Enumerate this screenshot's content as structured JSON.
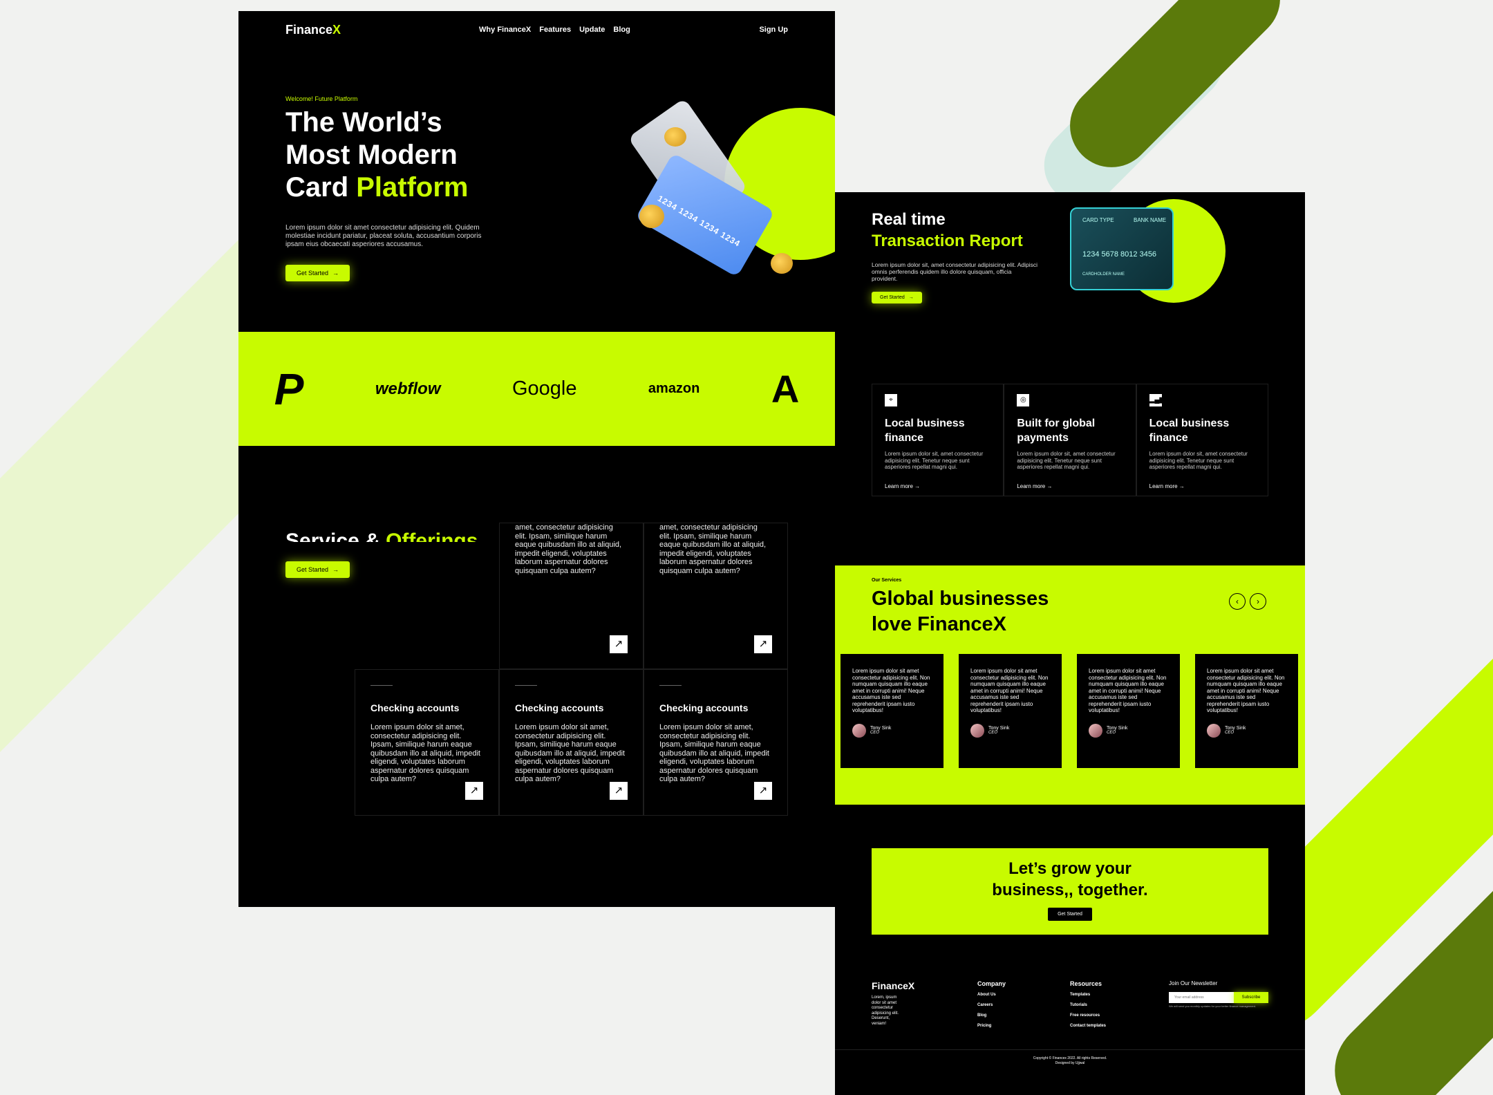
{
  "colors": {
    "accent": "#c8fb00",
    "bg": "#000000",
    "canvas": "#f1f2f0"
  },
  "page1": {
    "logo_main": "Finance",
    "logo_x": "X",
    "nav": [
      "Why FinanceX",
      "Features",
      "Update",
      "Blog"
    ],
    "signup": "Sign Up",
    "eyebrow": "Welcome! Future Platform",
    "hero_title_line1": "The World’s",
    "hero_title_line2": "Most Modern",
    "hero_title_line3a": "Card ",
    "hero_title_line3b": "Platform",
    "hero_desc": "Lorem ipsum dolor sit amet consectetur adipisicing elit. Quidem molestiae incidunt pariatur, placeat soluta, accusantium corporis ipsam eius obcaecati asperiores accusamus.",
    "hero_btn": "Get Started",
    "card_number": "1234 1234 1234 1234",
    "partners": [
      "P",
      "webflow",
      "Google",
      "amazon",
      "A"
    ],
    "offer_title_a": "Service & ",
    "offer_title_b": "Offerings",
    "offer_btn": "Get Started",
    "cell_title": "Checking accounts",
    "cell_desc": "Lorem ipsum dolor sit amet, consectetur adipisicing elit. Ipsam, similique harum eaque quibusdam illo at aliquid, impedit eligendi, voluptates laborum aspernatur dolores quisquam culpa autem?",
    "cell_desc_cut": "amet, consectetur adipisicing elit. Ipsam, similique harum eaque quibusdam illo at aliquid, impedit eligendi, voluptates laborum aspernatur dolores quisquam culpa autem?"
  },
  "page2": {
    "rt_title_line1": "Real time",
    "rt_title_line2": "Transaction Report",
    "rt_desc": "Lorem ipsum dolor sit, amet consectetur adipisicing elit. Adipisci omnis perferendis quidem illo dolore quisquam, officia provident.",
    "rt_btn": "Get Started",
    "bank_card": {
      "type": "CARD TYPE",
      "bank": "BANK NAME",
      "number": "1234 5678 8012 3456",
      "holder": "CARDHOLDER NAME"
    },
    "features": [
      {
        "icon": "location-pin-icon",
        "title": "Local business finance",
        "desc": "Lorem ipsum dolor sit, amet consectetur adipisicing elit. Tenetur neque sunt asperiores repellat magni qui.",
        "link": "Learn more →"
      },
      {
        "icon": "globe-icon",
        "title": "Built for global payments",
        "desc": "Lorem ipsum dolor sit, amet consectetur adipisicing elit. Tenetur neque sunt asperiores repellat magni qui.",
        "link": "Learn more →"
      },
      {
        "icon": "chart-icon",
        "title": "Local business finance",
        "desc": "Lorem ipsum dolor sit, amet consectetur adipisicing elit. Tenetur neque sunt asperiores repellat magni qui.",
        "link": "Learn more →"
      }
    ],
    "svc_eyebrow": "Our Services",
    "svc_title_line1": "Global businesses",
    "svc_title_line2": "love FinanceX",
    "testimonial_text": "Lorem ipsum dolor sit amet consectetur adipisicing elit. Non numquam quisquam illo eaque amet in corrupti animi! Neque accusamus iste sed reprehenderit ipsam iusto voluptatibus!",
    "testimonial_name": "Tony Sink",
    "testimonial_role": "CEO",
    "cta_title": "Let’s grow your business,, together.",
    "cta_btn": "Get Started",
    "footer_logo": "FinanceX",
    "footer_desc": "Lorem, ipsum dolor sit amet consectetur adipisicing elit. Deserunt, veniam!",
    "company_title": "Company",
    "company_links": [
      "About Us",
      "Careers",
      "Blog",
      "Pricing"
    ],
    "resources_title": "Resources",
    "resources_links": [
      "Templates",
      "Tutorials",
      "Free resources",
      "Contact templates"
    ],
    "newsletter_title": "Join Our Newsletter",
    "newsletter_placeholder": "Your email address",
    "newsletter_btn": "Subscribe",
    "newsletter_note": "We will send you monthly updates for your better finance management.",
    "copyright_line1": "Copyright © Financex 2022. All rights Reserved.",
    "copyright_line2": "Designed by Ujjwal"
  }
}
